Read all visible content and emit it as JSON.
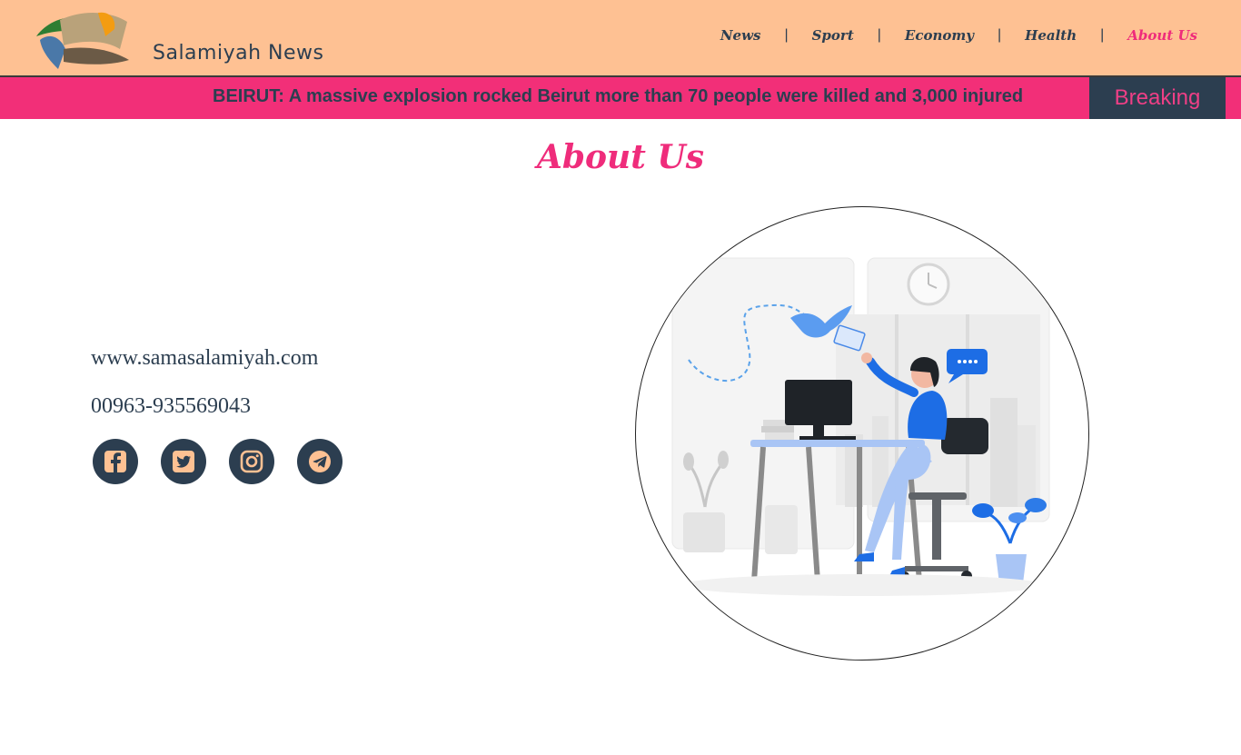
{
  "header": {
    "site_name": "Salamiyah News",
    "nav": [
      {
        "label": "News",
        "active": false
      },
      {
        "label": "Sport",
        "active": false
      },
      {
        "label": "Economy",
        "active": false
      },
      {
        "label": "Health",
        "active": false
      },
      {
        "label": "About Us",
        "active": true
      }
    ]
  },
  "ticker": {
    "headline": "BEIRUT: A massive explosion rocked Beirut more than 70 people were killed and 3,000 injured",
    "badge": "Breaking"
  },
  "main": {
    "title": "About Us",
    "website": "www.samasalamiyah.com",
    "phone": "00963-935569043",
    "socials": [
      {
        "icon": "facebook-icon"
      },
      {
        "icon": "twitter-icon"
      },
      {
        "icon": "instagram-icon"
      },
      {
        "icon": "telegram-icon"
      }
    ]
  },
  "colors": {
    "header_bg": "#fec193",
    "accent_pink": "#ef2c7b",
    "ticker_bg": "#f22f78",
    "dark_navy": "#2c3e50",
    "illustration_blue": "#1d6de5"
  }
}
